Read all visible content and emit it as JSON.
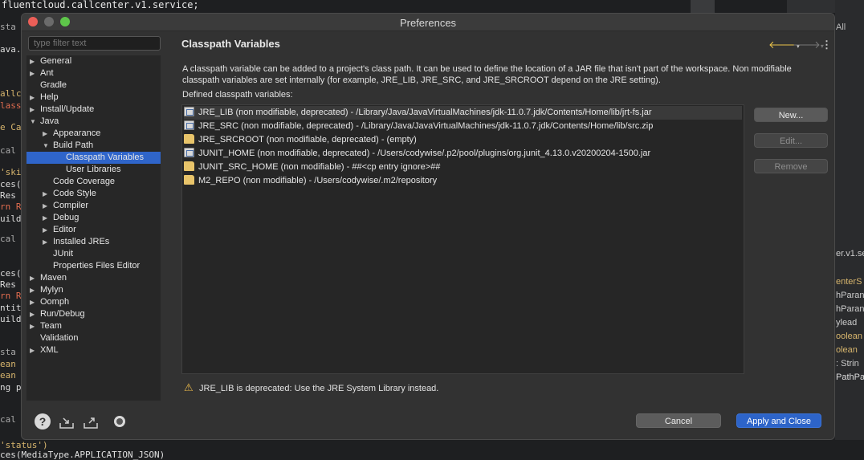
{
  "ide": {
    "top_line": "fluentcloud.callcenter.v1.service;",
    "bottom_line": "ces(MediaType.APPLICATION_JSON)",
    "status_line": "'status')",
    "left_fragments": [
      "sta",
      "ava.",
      "allc",
      "lass",
      "e Ca",
      "cal",
      "'ski",
      "ces(",
      "Res",
      "rn R",
      "uild",
      "cal",
      "ces(",
      "Res",
      "rn R",
      "ntit",
      "uild",
      "sta",
      "ean",
      "ean",
      "ng p",
      "cal"
    ],
    "right_fragments": [
      "All",
      "er.v1.se",
      "enterS",
      "hParan",
      "hParan",
      "ylead",
      "oolean",
      "olean",
      ": Strin",
      "PathPar"
    ]
  },
  "dialog": {
    "title": "Preferences",
    "filter_placeholder": "type filter text",
    "tree": [
      {
        "label": "General",
        "arrow": "▶",
        "level": 0
      },
      {
        "label": "Ant",
        "arrow": "▶",
        "level": 0
      },
      {
        "label": "Gradle",
        "arrow": "",
        "level": 0
      },
      {
        "label": "Help",
        "arrow": "▶",
        "level": 0
      },
      {
        "label": "Install/Update",
        "arrow": "▶",
        "level": 0
      },
      {
        "label": "Java",
        "arrow": "▼",
        "level": 0
      },
      {
        "label": "Appearance",
        "arrow": "▶",
        "level": 1
      },
      {
        "label": "Build Path",
        "arrow": "▼",
        "level": 1
      },
      {
        "label": "Classpath Variables",
        "arrow": "",
        "level": 2,
        "selected": true
      },
      {
        "label": "User Libraries",
        "arrow": "",
        "level": 2
      },
      {
        "label": "Code Coverage",
        "arrow": "",
        "level": 1
      },
      {
        "label": "Code Style",
        "arrow": "▶",
        "level": 1
      },
      {
        "label": "Compiler",
        "arrow": "▶",
        "level": 1
      },
      {
        "label": "Debug",
        "arrow": "▶",
        "level": 1
      },
      {
        "label": "Editor",
        "arrow": "▶",
        "level": 1
      },
      {
        "label": "Installed JREs",
        "arrow": "▶",
        "level": 1
      },
      {
        "label": "JUnit",
        "arrow": "",
        "level": 1
      },
      {
        "label": "Properties Files Editor",
        "arrow": "",
        "level": 1
      },
      {
        "label": "Maven",
        "arrow": "▶",
        "level": 0
      },
      {
        "label": "Mylyn",
        "arrow": "▶",
        "level": 0
      },
      {
        "label": "Oomph",
        "arrow": "▶",
        "level": 0
      },
      {
        "label": "Run/Debug",
        "arrow": "▶",
        "level": 0
      },
      {
        "label": "Team",
        "arrow": "▶",
        "level": 0
      },
      {
        "label": "Validation",
        "arrow": "",
        "level": 0
      },
      {
        "label": "XML",
        "arrow": "▶",
        "level": 0
      }
    ],
    "page": {
      "title": "Classpath Variables",
      "description": "A classpath variable can be added to a project's class path. It can be used to define the location of a JAR file that isn't part of the workspace. Non modifiable classpath variables are set internally (for example, JRE_LIB, JRE_SRC, and JRE_SRCROOT depend on the JRE setting).",
      "defined_label": "Defined classpath variables:",
      "variables": [
        {
          "text": "JRE_LIB (non modifiable, deprecated) - /Library/Java/JavaVirtualMachines/jdk-11.0.7.jdk/Contents/Home/lib/jrt-fs.jar",
          "icon": "jar-file-icon",
          "selected": true
        },
        {
          "text": "JRE_SRC (non modifiable, deprecated) - /Library/Java/JavaVirtualMachines/jdk-11.0.7.jdk/Contents/Home/lib/src.zip",
          "icon": "jar-file-icon"
        },
        {
          "text": "JRE_SRCROOT (non modifiable, deprecated) - (empty)",
          "icon": "folder-icon"
        },
        {
          "text": "JUNIT_HOME (non modifiable, deprecated) - /Users/codywise/.p2/pool/plugins/org.junit_4.13.0.v20200204-1500.jar",
          "icon": "jar-file-icon"
        },
        {
          "text": "JUNIT_SRC_HOME (non modifiable) - ##<cp entry ignore>##",
          "icon": "folder-icon"
        },
        {
          "text": "M2_REPO (non modifiable) - /Users/codywise/.m2/repository",
          "icon": "folder-icon"
        }
      ],
      "buttons": {
        "new": "New...",
        "edit": "Edit...",
        "remove": "Remove"
      },
      "warning": "JRE_LIB is deprecated: Use the JRE System Library instead."
    },
    "footer": {
      "cancel": "Cancel",
      "apply_close": "Apply and Close"
    }
  }
}
